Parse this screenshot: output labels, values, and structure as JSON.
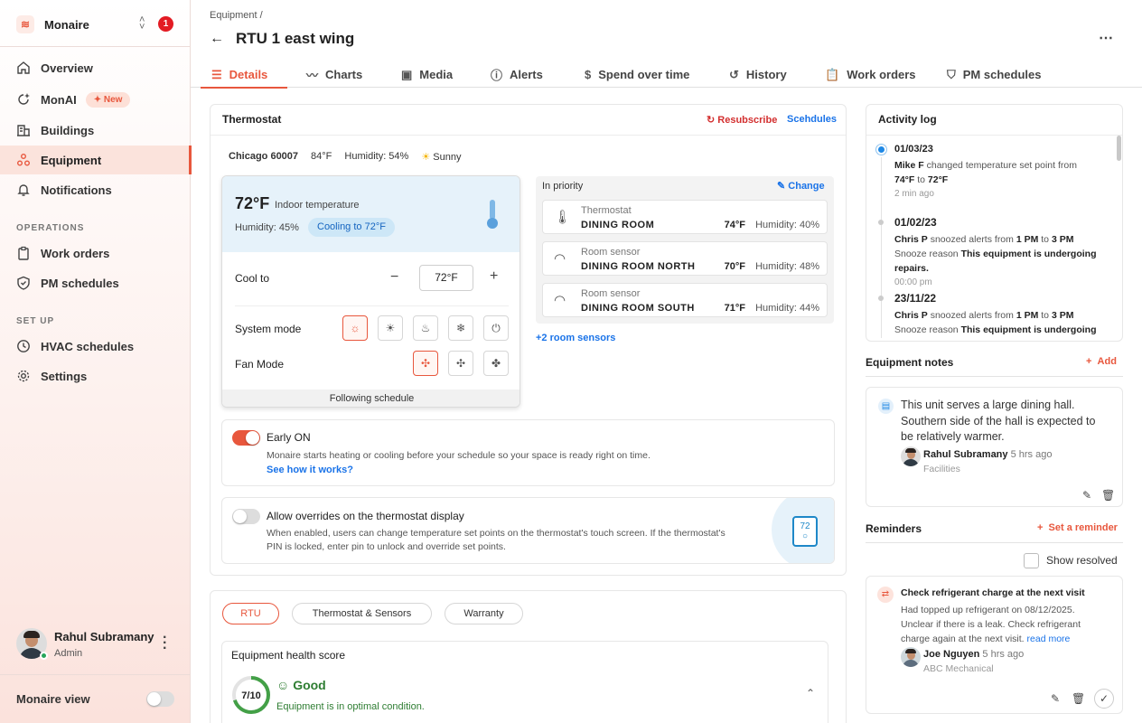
{
  "brand": {
    "name": "Monaire",
    "notifications": "1"
  },
  "sidebar": {
    "items": [
      {
        "label": "Overview"
      },
      {
        "label": "MonAI",
        "badge": "New"
      },
      {
        "label": "Buildings"
      },
      {
        "label": "Equipment"
      },
      {
        "label": "Notifications"
      }
    ],
    "operations_title": "OPERATIONS",
    "operations": [
      {
        "label": "Work orders"
      },
      {
        "label": "PM schedules"
      }
    ],
    "setup_title": "SET UP",
    "setup": [
      {
        "label": "HVAC schedules"
      },
      {
        "label": "Settings"
      }
    ],
    "user": {
      "name": "Rahul Subramany",
      "role": "Admin"
    },
    "view_label": "Monaire view"
  },
  "header": {
    "breadcrumb": "Equipment /",
    "title": "RTU 1 east wing"
  },
  "tabs": [
    {
      "label": "Details"
    },
    {
      "label": "Charts"
    },
    {
      "label": "Media"
    },
    {
      "label": "Alerts"
    },
    {
      "label": "Spend over time"
    },
    {
      "label": "History"
    },
    {
      "label": "Work orders"
    },
    {
      "label": "PM schedules"
    }
  ],
  "thermostat": {
    "title": "Thermostat",
    "resubscribe": "Resubscribe",
    "schedules": "Scehdules",
    "location": "Chicago 60007",
    "outdoor_temp": "84°F",
    "outdoor_humidity": "Humidity: 54%",
    "weather": "Sunny",
    "indoor_temp": "72°F",
    "indoor_label": "Indoor temperature",
    "indoor_humidity": "Humidity: 45%",
    "status": "Cooling to 72°F",
    "cool_to_label": "Cool to",
    "cool_to_value": "72°F",
    "minus": "−",
    "plus": "+",
    "system_mode_label": "System mode",
    "fan_mode_label": "Fan Mode",
    "footer": "Following schedule",
    "priority_title": "In priority",
    "change": "Change",
    "sensors": [
      {
        "type": "Thermostat",
        "name": "DINING ROOM",
        "temp": "74°F",
        "humidity": "Humidity: 40%"
      },
      {
        "type": "Room sensor",
        "name": "DINING ROOM NORTH",
        "temp": "70°F",
        "humidity": "Humidity: 48%"
      },
      {
        "type": "Room sensor",
        "name": "DINING ROOM SOUTH",
        "temp": "71°F",
        "humidity": "Humidity: 44%"
      }
    ],
    "more_sensors": "+2 room sensors",
    "early_on": {
      "title": "Early ON",
      "desc": "Monaire starts heating or cooling before your schedule so your space is ready right on time.",
      "link": "See how it works?",
      "enabled": true
    },
    "overrides": {
      "title": "Allow overrides on the thermostat display",
      "desc1": "When enabled, users can change temperature set points on the thermostat's touch screen. If the thermostat's",
      "desc2": "PIN is locked, enter pin to unlock and override set points.",
      "display_value": "72",
      "enabled": false
    }
  },
  "health": {
    "tabs": [
      "RTU",
      "Thermostat & Sensors",
      "Warranty"
    ],
    "title": "Equipment health score",
    "score": "7/10",
    "score_fraction": 0.7,
    "rating": "Good",
    "desc": "Equipment is in optimal condition."
  },
  "activity": {
    "title": "Activity log",
    "entries": [
      {
        "date": "01/03/23",
        "user": "Mike F",
        "text": "changed temperature set point from",
        "from": "74°F",
        "to_word": "to",
        "to": "72°F",
        "time": "2 min ago"
      },
      {
        "date": "01/02/23",
        "user": "Chris P",
        "text": "snoozed alerts from",
        "from": "1 PM",
        "to_word": "to",
        "to": "3 PM",
        "reason_label": "Snooze reason",
        "reason": "This equipment is undergoing",
        "reason2": "repairs.",
        "time": "00:00 pm"
      },
      {
        "date": "23/11/22",
        "user": "Chris P",
        "text": "snoozed alerts from",
        "from": "1 PM",
        "to_word": "to",
        "to": "3 PM",
        "reason_label": "Snooze reason",
        "reason": "This equipment is undergoing"
      }
    ]
  },
  "notes": {
    "title": "Equipment notes",
    "add": "Add",
    "text1": "This unit serves a large dining hall.",
    "text2": "Southern side of the hall is expected to",
    "text3": "be relatively warmer.",
    "author": "Rahul Subramany",
    "time": "5 hrs ago",
    "team": "Facilities"
  },
  "reminders": {
    "title": "Reminders",
    "set": "Set a reminder",
    "show_resolved": "Show resolved",
    "item": {
      "title": "Check refrigerant charge at the next visit",
      "line1": "Had topped up refrigerant on 08/12/2025.",
      "line2": "Unclear if there is a leak. Check refrigerant",
      "line3": "charge again at the next visit.",
      "more": "read more",
      "author": "Joe Nguyen",
      "time": "5 hrs ago",
      "team": "ABC Mechanical"
    }
  }
}
